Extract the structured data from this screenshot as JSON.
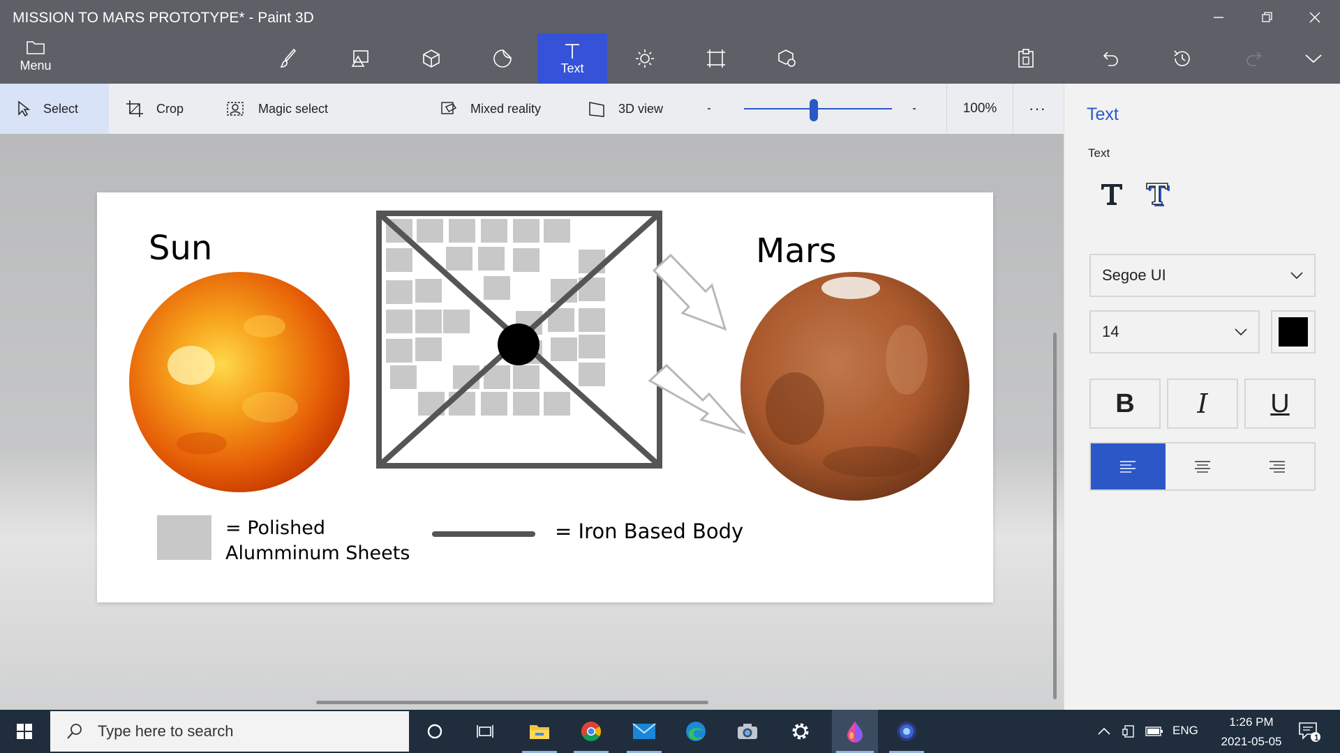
{
  "window": {
    "title": "MISSION TO MARS PROTOTYPE* - Paint 3D",
    "controls": [
      "minimize-icon",
      "restore-icon",
      "close-icon"
    ]
  },
  "ribbon": {
    "menu_label": "Menu",
    "tools": [
      {
        "name": "brushes",
        "icon": "brush-icon"
      },
      {
        "name": "2d-shapes",
        "icon": "2d-shapes-icon"
      },
      {
        "name": "3d-shapes",
        "icon": "cube-icon"
      },
      {
        "name": "stickers",
        "icon": "sticker-icon"
      },
      {
        "name": "text",
        "icon": "text-icon",
        "label": "Text",
        "active": true
      },
      {
        "name": "effects",
        "icon": "sun-icon"
      },
      {
        "name": "canvas",
        "icon": "canvas-icon"
      },
      {
        "name": "3d-library",
        "icon": "3d-library-icon"
      }
    ],
    "right_icons": [
      "paste-icon",
      "undo-icon",
      "history-icon",
      "redo-icon",
      "expand-icon"
    ]
  },
  "toolbar": {
    "select_label": "Select",
    "crop_label": "Crop",
    "magic_select_label": "Magic select",
    "mixed_reality_label": "Mixed reality",
    "view3d_label": "3D view",
    "zoom_value": "100%",
    "zoom_slider_fraction": 0.47,
    "more_label": "···"
  },
  "canvas": {
    "sun_label": "Sun",
    "mars_label": "Mars",
    "legend_eq1": "= Polished",
    "legend_line2": "Alumminum Sheets",
    "legend_eq2": "= Iron Based Body",
    "colors": {
      "aluminum": "#c8c8c8",
      "iron": "#555555",
      "sun_core": "#ffd84a",
      "sun_edge": "#c83a00",
      "mars_core": "#c0784a",
      "mars_edge": "#6e3518"
    }
  },
  "panel": {
    "title": "Text",
    "subtitle": "Text",
    "text_types": [
      "2d-text-icon",
      "3d-text-icon"
    ],
    "font": "Segoe UI",
    "size": "14",
    "color": "#000000",
    "bold": "B",
    "italic": "I",
    "underline": "U",
    "alignments": [
      "align-left-icon",
      "align-center-icon",
      "align-right-icon"
    ],
    "active_alignment": "left"
  },
  "taskbar": {
    "search_placeholder": "Type here to search",
    "apps": [
      "cortana-icon",
      "task-view-icon",
      "file-explorer-icon",
      "chrome-icon",
      "mail-icon",
      "edge-icon",
      "camera-icon",
      "settings-icon",
      "paint3d-icon",
      "app-icon"
    ],
    "language": "ENG",
    "time": "1:26 PM",
    "date": "2021-05-05",
    "notifications": "1"
  }
}
